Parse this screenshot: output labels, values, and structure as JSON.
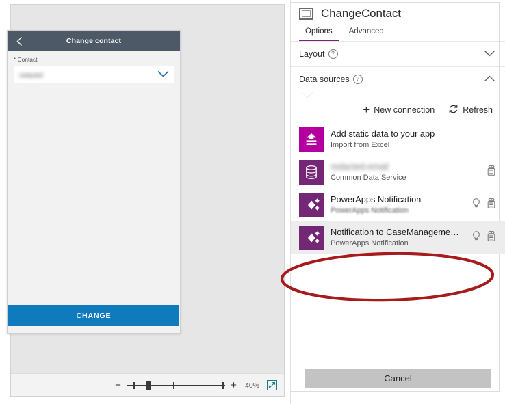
{
  "canvas": {
    "phone": {
      "header": {
        "back_icon": "chevron-left-icon",
        "title": "Change contact"
      },
      "form": {
        "field_label": "Contact",
        "required_marker": "*",
        "value": "redacted",
        "chevron_icon": "chevron-down-icon"
      },
      "submit_label": "CHANGE"
    },
    "statusbar": {
      "zoom_out_label": "−",
      "zoom_in_label": "+",
      "zoom_percent": "40%",
      "fit_icon": "fit-to-screen-icon"
    }
  },
  "panel": {
    "header": {
      "icon": "screen-control-icon",
      "title": "ChangeContact"
    },
    "tabs": [
      {
        "label": "Options",
        "active": true
      },
      {
        "label": "Advanced",
        "active": false
      }
    ],
    "sections": [
      {
        "title": "Layout",
        "help_icon": "help-circle-icon",
        "expanded": false,
        "chevron_icon": "chevron-down-icon"
      },
      {
        "title": "Data sources",
        "help_icon": "help-circle-icon",
        "expanded": true,
        "chevron_icon": "chevron-up-icon"
      }
    ],
    "data_sources": {
      "actions": [
        {
          "label": "New connection",
          "icon": "plus-icon"
        },
        {
          "label": "Refresh",
          "icon": "refresh-icon"
        }
      ],
      "items": [
        {
          "name": "Add static data to your app",
          "subtitle": "Import from Excel",
          "icon": "static-data-icon",
          "icon_color": "#B4009E",
          "redacted": false,
          "show_lightbulb": false,
          "show_remove": false,
          "highlighted": false
        },
        {
          "name": "redacted-email",
          "subtitle": "Common Data Service",
          "icon": "database-icon",
          "icon_color": "#742774",
          "redacted": true,
          "show_lightbulb": false,
          "show_remove": true,
          "highlighted": false
        },
        {
          "name": "PowerApps Notification",
          "subtitle": "PowerApps Notification",
          "icon": "powerapps-notification-icon",
          "icon_color": "#742774",
          "redacted": false,
          "show_lightbulb": true,
          "show_remove": true,
          "highlighted": false
        },
        {
          "name": "Notification to CaseManageme…",
          "subtitle": "PowerApps Notification",
          "icon": "powerapps-notification-icon",
          "icon_color": "#742774",
          "redacted": false,
          "show_lightbulb": true,
          "show_remove": true,
          "highlighted": true
        }
      ]
    },
    "cancel_label": "Cancel"
  },
  "annotation": {
    "shape": "ellipse",
    "color": "#A61B1B",
    "targets": "Notification to CaseManageme… data source row"
  }
}
